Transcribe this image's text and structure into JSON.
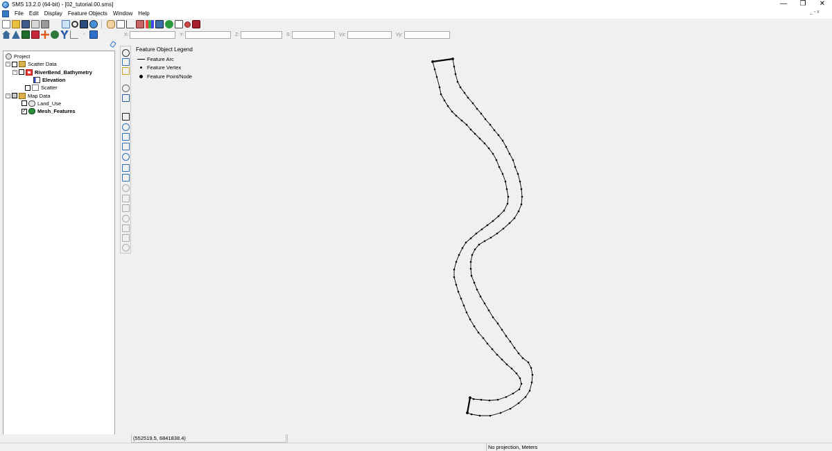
{
  "window": {
    "title": "SMS 13.2.0 (64-bit) - [02_tutorial.00.sms]",
    "minimize_glyph": "—",
    "restore_glyph": "❐",
    "close_glyph": "✕",
    "mdi_controls": "_ ▫ x"
  },
  "menu": [
    "File",
    "Edit",
    "Display",
    "Feature Objects",
    "Window",
    "Help"
  ],
  "coord_bar": {
    "x_label": "X:",
    "y_label": "Y:",
    "z_label": "Z:",
    "s_label": "S:",
    "vx_label": "Vx:",
    "vy_label": "Vy:",
    "x_value": "",
    "y_value": "",
    "z_value": "",
    "s_value": "",
    "vx_value": "",
    "vy_value": ""
  },
  "tree": {
    "project": "Project",
    "scatter_data": "Scatter Data",
    "riverbend_bathymetry": "RiverBend_Bathymetry",
    "elevation": "Elevation",
    "scatter": "Scatter",
    "map_data": "Map Data",
    "land_use": "Land_Use",
    "mesh_features": "Mesh_Features",
    "collapse_glyph": "−",
    "check_glyph": "✓"
  },
  "legend": {
    "title": "Feature Object Legend",
    "arc": "Feature Arc",
    "vertex": "Feature Vertex",
    "node": "Feature Point/Node"
  },
  "status": {
    "cursor_coords": "(552519.5, 6841838.4)",
    "projection": "No projection, Meters"
  },
  "icons": {
    "toolbar1": [
      "new-file-icon",
      "open-folder-icon",
      "save-icon",
      "print-icon",
      "delete-icon",
      "frame-icon",
      "zoom-icon",
      "display-options-icon",
      "get-info-icon",
      "pan-hand-icon",
      "rectangle-icon",
      "plot-icon",
      "chart-icon",
      "bar-chart-icon",
      "import-icon",
      "globe-icon",
      "copy-icon",
      "settings-icon",
      "toolbox-icon"
    ],
    "toolbar2": [
      "1d-module-icon",
      "2d-mesh-module-icon",
      "cartesian-grid-icon",
      "scatter-module-icon",
      "gis-module-icon",
      "map-module-icon",
      "particle-module-icon",
      "profile-module-icon",
      "annotation-module-icon",
      "generic-model-icon"
    ],
    "vertical": [
      "pan-icon",
      "zoom-icon",
      "rotate-icon",
      "measure-icon",
      "display-icon",
      "select-icon",
      "select-arc-icon",
      "select-vertex-icon",
      "create-arc-icon",
      "create-point-icon",
      "select-node-icon",
      "create-polygon-icon",
      "select-polygon-icon",
      "select-arc-group-icon",
      "create-feature-point-icon",
      "draw-icon",
      "select-polygon-2-icon",
      "rectangle-select-icon",
      "zoom-extent-icon",
      "redistribute-icon"
    ]
  },
  "colors": {
    "tree_selected_check": "#2e8b3a",
    "scatter_icon": "#c00000",
    "map_icon": "#2e8b3a",
    "canvas_background": "#f0f0f0",
    "feature_arc": "#000000"
  }
}
